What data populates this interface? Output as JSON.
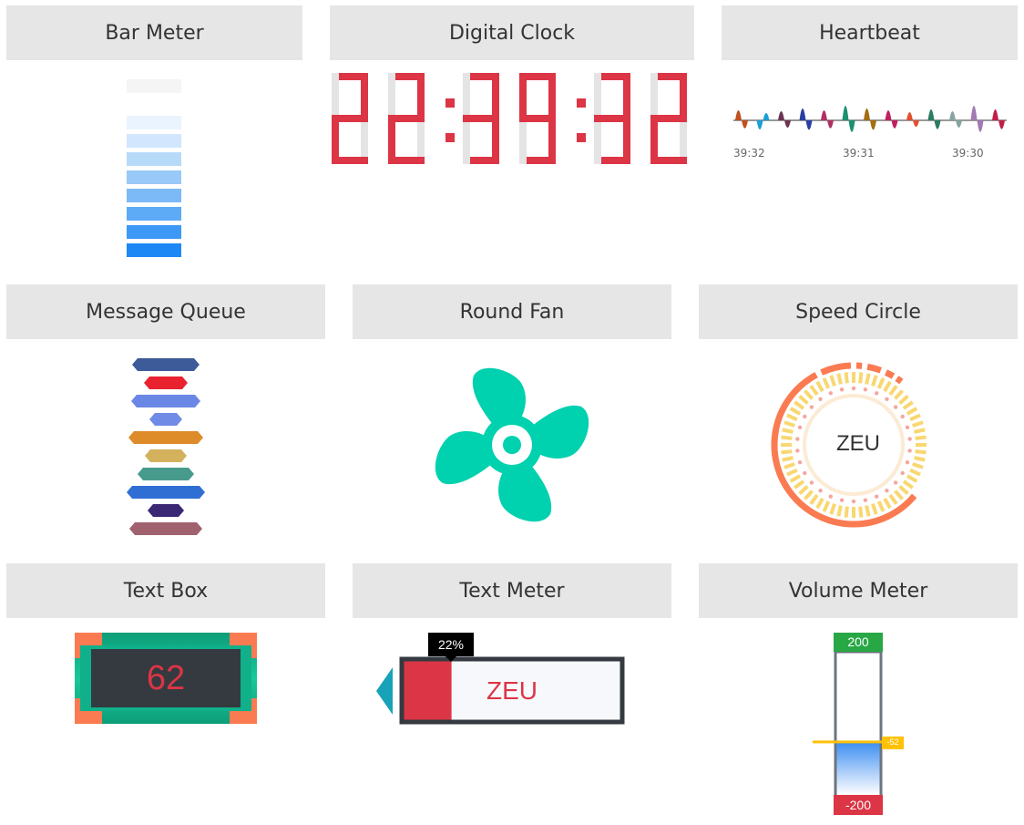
{
  "widgets": {
    "bar_meter": {
      "title": "Bar Meter"
    },
    "digital_clock": {
      "title": "Digital Clock",
      "time": "22:39:32"
    },
    "heartbeat": {
      "title": "Heartbeat",
      "time_labels": [
        "39:32",
        "39:31",
        "39:30"
      ]
    },
    "message_queue": {
      "title": "Message Queue"
    },
    "round_fan": {
      "title": "Round Fan"
    },
    "speed_circle": {
      "title": "Speed Circle",
      "label": "ZEU"
    },
    "text_box": {
      "title": "Text Box",
      "value": "62"
    },
    "text_meter": {
      "title": "Text Meter",
      "percent_label": "22%",
      "level": 0.22,
      "text": "ZEU"
    },
    "volume_meter": {
      "title": "Volume Meter",
      "max_label": "200",
      "min_label": "-200",
      "marker_label": "-52",
      "value": -52,
      "range": [
        -200,
        200
      ]
    }
  },
  "colors": {
    "header_bg": "#e6e6e6",
    "bar_blue": "#1e88f5",
    "clock_red": "#dc3545",
    "clock_off": "#e4e4e4",
    "fan_teal": "#00d1ae",
    "speed_orange": "#fa7b52",
    "speed_yellow": "#f9d771",
    "textbox_green": "#17b58c",
    "textbox_corner": "#fa7b52",
    "textbox_screen": "#343a40",
    "textbox_digits": "#dc3545",
    "volume_top": "#28a745",
    "volume_bottom": "#dc3545",
    "volume_marker": "#ffc107",
    "meter_cyan": "#17a2b8"
  }
}
